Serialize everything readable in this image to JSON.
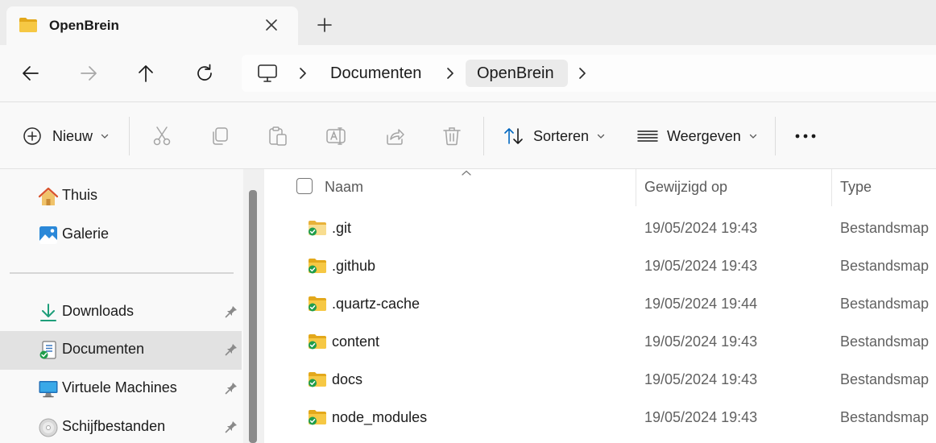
{
  "tab": {
    "title": "OpenBrein",
    "icon": "folder-icon"
  },
  "nav": {
    "back": "back-arrow-icon",
    "forward": "forward-arrow-icon",
    "up": "up-arrow-icon",
    "refresh": "refresh-icon"
  },
  "breadcrumb": [
    {
      "label": "Documenten"
    },
    {
      "label": "OpenBrein"
    }
  ],
  "commands": {
    "new_label": "Nieuw",
    "sort_label": "Sorteren",
    "view_label": "Weergeven",
    "disabled_icons": [
      "cut-icon",
      "copy-icon",
      "paste-icon",
      "rename-icon",
      "share-icon",
      "delete-icon"
    ]
  },
  "sidebar": {
    "top_items": [
      {
        "label": "Thuis",
        "icon": "home-icon"
      },
      {
        "label": "Galerie",
        "icon": "gallery-icon"
      }
    ],
    "quick_access": [
      {
        "label": "Downloads",
        "icon": "download-icon",
        "pinned": true,
        "selected": false
      },
      {
        "label": "Documenten",
        "icon": "documents-icon",
        "pinned": true,
        "selected": true
      },
      {
        "label": "Virtuele Machines",
        "icon": "monitor-icon",
        "pinned": true,
        "selected": false
      },
      {
        "label": "Schijfbestanden",
        "icon": "disc-icon",
        "pinned": true,
        "selected": false
      }
    ]
  },
  "list": {
    "columns": {
      "name": "Naam",
      "modified": "Gewijzigd op",
      "type": "Type"
    },
    "rows": [
      {
        "name": ".git",
        "modified": "19/05/2024 19:43",
        "type": "Bestandsmap"
      },
      {
        "name": ".github",
        "modified": "19/05/2024 19:43",
        "type": "Bestandsmap"
      },
      {
        "name": ".quartz-cache",
        "modified": "19/05/2024 19:44",
        "type": "Bestandsmap"
      },
      {
        "name": "content",
        "modified": "19/05/2024 19:43",
        "type": "Bestandsmap"
      },
      {
        "name": "docs",
        "modified": "19/05/2024 19:43",
        "type": "Bestandsmap"
      },
      {
        "name": "node_modules",
        "modified": "19/05/2024 19:43",
        "type": "Bestandsmap"
      }
    ]
  },
  "colors": {
    "folder": "#f4c542",
    "folder_dark": "#e3a81b",
    "sync_badge": "#1f9d4c",
    "accent": "#0067c0"
  }
}
